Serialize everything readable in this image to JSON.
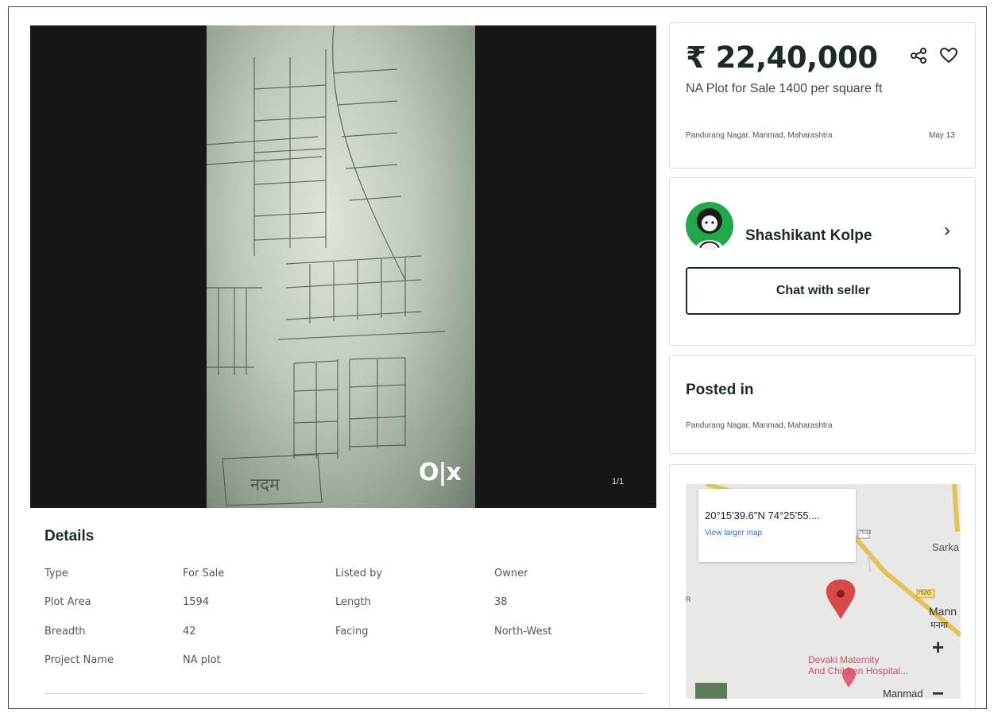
{
  "gallery": {
    "counter": "1/1",
    "logo_text": "O|x"
  },
  "details": {
    "title": "Details",
    "rows": [
      {
        "label": "Type",
        "value": "For Sale",
        "label2": "Listed by",
        "value2": "Owner"
      },
      {
        "label": "Plot Area",
        "value": "1594",
        "label2": "Length",
        "value2": "38"
      },
      {
        "label": "Breadth",
        "value": "42",
        "label2": "Facing",
        "value2": "North-West"
      },
      {
        "label": "Project Name",
        "value": "NA plot",
        "label2": "",
        "value2": ""
      }
    ]
  },
  "listing": {
    "price": "₹ 22,40,000",
    "title": "NA Plot for Sale 1400 per square ft",
    "location": "Pandurang Nagar, Manmad, Maharashtra",
    "date": "May 13"
  },
  "seller": {
    "name": "Shashikant Kolpe",
    "chat_label": "Chat with seller"
  },
  "posted": {
    "title": "Posted in",
    "location": "Pandurang Nagar, Manmad, Maharashtra"
  },
  "map": {
    "coords": "20°15'39.6\"N 74°25'55....",
    "larger_map": "View larger map",
    "labels": {
      "sarka": "Sarka",
      "manm": "Mann",
      "manm_dev": "मनमा",
      "hospital_1": "Devaki Maternity",
      "hospital_2": "And Children Hospital...",
      "manmad": "Manmad",
      "road1": "753J",
      "road2": "752G",
      "r_label": "R"
    },
    "zoom_in": "+",
    "zoom_out": "−"
  },
  "icons": {
    "share": "share-icon",
    "favorite": "heart-icon",
    "chevron": "chevron-right-icon"
  }
}
